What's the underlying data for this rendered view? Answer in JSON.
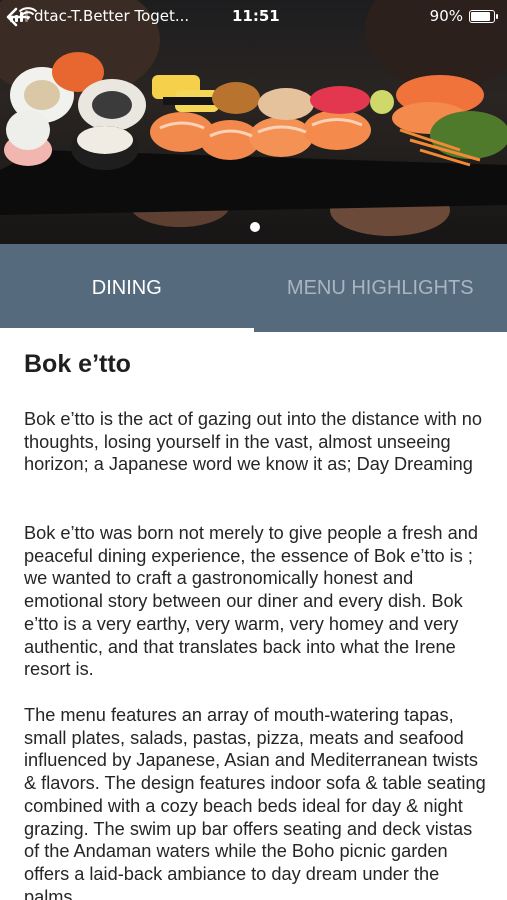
{
  "status_bar": {
    "carrier": "dtac-T.Better Toget...",
    "time": "11:51",
    "battery_text": "90%",
    "battery_level": 0.9,
    "signal_icon": "signal-icon",
    "wifi_icon": "wifi-icon"
  },
  "hero": {
    "image": "sushi-platter",
    "carousel_dots": 1,
    "active_dot": 0
  },
  "tabs": [
    {
      "label": "DINING",
      "active": true
    },
    {
      "label": "MENU HIGHLIGHTS",
      "active": false
    }
  ],
  "article": {
    "title": "Bok e’tto",
    "paragraphs": [
      "Bok e’tto is the act of gazing out into the distance with no thoughts, losing yourself in the vast, almost unseeing horizon; a Japanese word we know it as; Day Dreaming",
      "Bok e’tto was born not merely to give people a fresh and peaceful dining experience, the essence of Bok e’tto is ; we wanted to craft a gastronomically honest and emotional story between our diner and every dish. Bok e’tto is a very earthy, very warm, very homey and very authentic, and that translates back into what the Irene resort is.",
      "The menu features an array of mouth-watering tapas, small plates, salads, pastas, pizza, meats and seafood influenced by Japanese, Asian and Mediterranean twists & flavors. The design features indoor sofa & table seating combined with a cozy beach beds ideal for day & night grazing. The swim up bar offers seating and deck vistas of the Andaman waters while the Boho picnic garden offers a laid-back ambiance to day dream under the palms"
    ]
  },
  "colors": {
    "tab_bar": "#566a7e",
    "tab_inactive_text": "#aab5c2",
    "text": "#262626"
  }
}
